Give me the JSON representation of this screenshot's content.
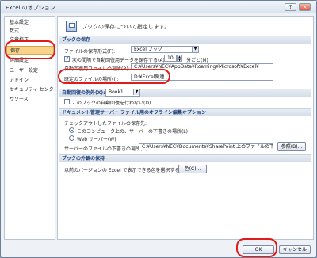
{
  "window": {
    "title": "Excel のオプション",
    "help_glyph": "?",
    "close_glyph": "×"
  },
  "sidebar": {
    "items": [
      {
        "label": "基本設定"
      },
      {
        "label": "数式"
      },
      {
        "label": "文章校正"
      },
      {
        "label": "保存"
      },
      {
        "label": "詳細設定"
      },
      {
        "label": "ユーザー設定"
      },
      {
        "label": "アドイン"
      },
      {
        "label": "セキュリティ センター"
      },
      {
        "label": "リソース"
      }
    ]
  },
  "header": {
    "text": "ブックの保存について指定します。"
  },
  "sections": {
    "save": {
      "title": "ブックの保存",
      "format_label": "ファイルの保存形式(F):",
      "format_value": "Excel ブック",
      "autorecover_label": "次の間隔で自動回復用データを保存する(A):",
      "autorecover_minutes": "10",
      "minutes_unit": "分ごと(M)",
      "recover_location_label": "自動回復用ファイルの場所(R):",
      "recover_location_value": "C:¥Users¥NEC¥AppData¥Roaming¥Microsoft¥Excel¥",
      "default_location_label": "既定のファイルの場所(I):",
      "default_location_value": "D:¥Excel関連"
    },
    "autorecover_except": {
      "title": "自動回復の例外(X):",
      "book_value": "Book1",
      "disable_label": "このブックの自動回復を行わない(D)"
    },
    "offline": {
      "title": "ドキュメント管理サーバー ファイル用のオフライン編集オプション",
      "checkout_label": "チェックアウトしたファイルの保存先:",
      "radio1": "このコンピュータ上の、サーバーの下書きの場所(L)",
      "radio2": "Web サーバー(W)",
      "drafts_label": "サーバーのファイルの下書きの場所(V):",
      "drafts_value": "C:¥Users¥NEC¥Documents¥SharePoint 上のファイルの下書き¥",
      "browse_label": "参照(B)..."
    },
    "appearance": {
      "title": "ブックの外観の保持",
      "colors_label": "以前のバージョンの Excel で表示できる色を選択する:",
      "colors_button": "色(C)..."
    }
  },
  "footer": {
    "ok_label": "OK",
    "cancel_label": "キャンセル"
  },
  "colors": {
    "highlight_ring": "#e31a1a",
    "active_item": "#f7d489",
    "section_text": "#1e3f78"
  }
}
